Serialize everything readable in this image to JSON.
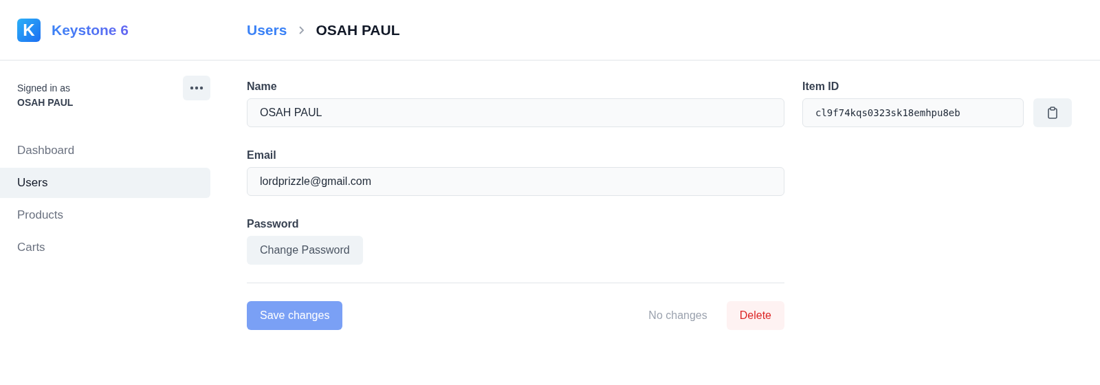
{
  "brand": {
    "logo_letter": "K",
    "name": "Keystone 6"
  },
  "breadcrumb": {
    "parent": "Users",
    "current": "OSAH PAUL"
  },
  "sidebar": {
    "signed_in_label": "Signed in as",
    "user_name": "OSAH PAUL",
    "items": [
      {
        "label": "Dashboard",
        "selected": false
      },
      {
        "label": "Users",
        "selected": true
      },
      {
        "label": "Products",
        "selected": false
      },
      {
        "label": "Carts",
        "selected": false
      }
    ]
  },
  "form": {
    "fields": [
      {
        "kind": "text",
        "label": "Name",
        "value": "OSAH PAUL"
      },
      {
        "kind": "text",
        "label": "Email",
        "value": "lordprizzle@gmail.com"
      },
      {
        "kind": "button",
        "label": "Password",
        "button": "Change Password"
      }
    ],
    "save_button": {
      "label": "Save changes",
      "disabled": true
    },
    "status": "No changes",
    "delete_button": "Delete"
  },
  "item_id": {
    "label": "Item ID",
    "value": "cl9f74kqs0323sk18emhpu8eb"
  }
}
